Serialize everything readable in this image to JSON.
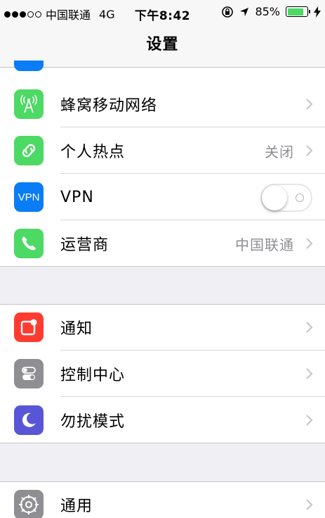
{
  "status_bar": {
    "signal_dots": [
      true,
      true,
      true,
      false,
      false
    ],
    "carrier": "中国联通",
    "network": "4G",
    "time": "下午8:42",
    "battery_percent": "85%",
    "battery_level": 0.85,
    "icons": [
      "orientation-lock-icon",
      "location-arrow-icon",
      "charging-bolt-icon"
    ]
  },
  "nav": {
    "title": "设置"
  },
  "group1": {
    "items": [
      {
        "label": "蜂窝移动网络",
        "detail": "",
        "icon": "cellular-antenna-icon",
        "icon_color": "#4cd964"
      },
      {
        "label": "个人热点",
        "detail": "关闭",
        "icon": "hotspot-chain-icon",
        "icon_color": "#4cd964"
      },
      {
        "label": "VPN",
        "icon_text": "VPN",
        "icon": "vpn-icon",
        "icon_color": "#0a7cf6",
        "toggle_on": false
      },
      {
        "label": "运营商",
        "detail": "中国联通",
        "icon": "phone-icon",
        "icon_color": "#4cd964"
      }
    ]
  },
  "group2": {
    "items": [
      {
        "label": "通知",
        "icon": "notifications-icon",
        "icon_color": "#ff3b30"
      },
      {
        "label": "控制中心",
        "icon": "control-center-icon",
        "icon_color": "#8e8e93"
      },
      {
        "label": "勿扰模式",
        "icon": "moon-icon",
        "icon_color": "#5856d6"
      }
    ]
  },
  "group3": {
    "items": [
      {
        "label": "通用",
        "icon": "gear-icon",
        "icon_color": "#8e8e93"
      }
    ]
  }
}
